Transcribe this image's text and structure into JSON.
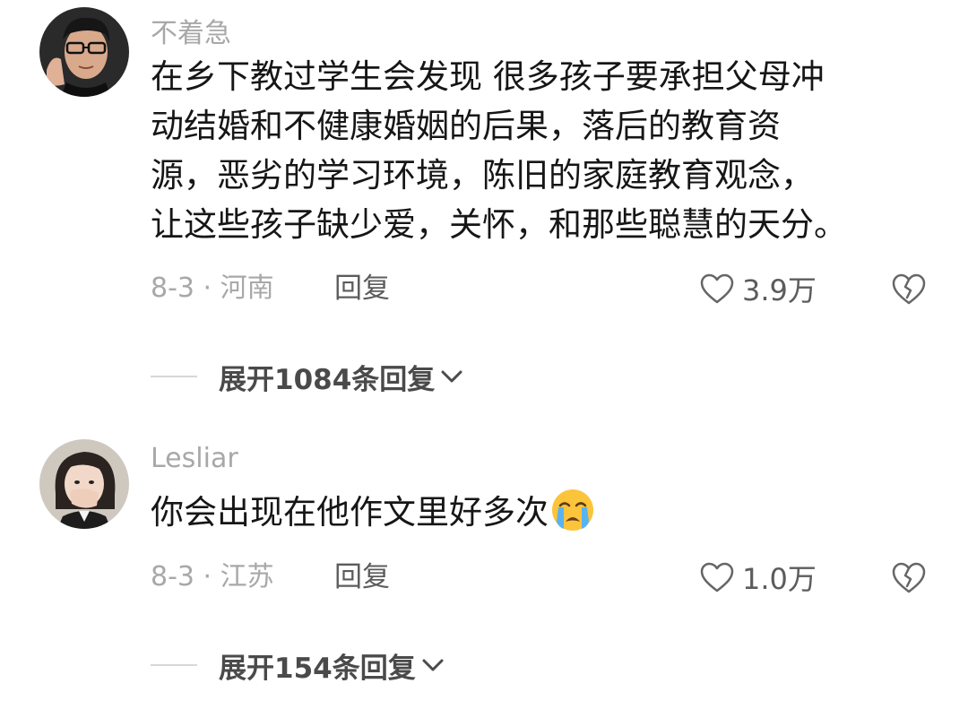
{
  "comments": [
    {
      "username": "不着急",
      "avatar_icon": "avatar-man-glasses",
      "lines": [
        "在乡下教过学生会发现 很多孩子要承担父母冲",
        "动结婚和不健康婚姻的后果，落后的教育资",
        "源，恶劣的学习环境，陈旧的家庭教育观念，",
        "让这些孩子缺少爱，关怀，和那些聪慧的天分。"
      ],
      "date_location": "8-3 · 河南",
      "reply_label": "回复",
      "like_count": "3.9万",
      "like_icon": "heart-outline-icon",
      "dislike_icon": "broken-heart-icon",
      "expand_label": "展开1084条回复"
    },
    {
      "username": "Lesliar",
      "avatar_icon": "avatar-woman-covering-mouth",
      "lines": [
        "你会出现在他作文里好多次"
      ],
      "emoji": "loudly-crying-face-emoji",
      "date_location": "8-3 · 江苏",
      "reply_label": "回复",
      "like_count": "1.0万",
      "like_icon": "heart-outline-icon",
      "dislike_icon": "broken-heart-icon",
      "expand_label": "展开154条回复"
    }
  ],
  "colors": {
    "username": "#a8a8a8",
    "body": "#161616",
    "meta": "#a8a8a8",
    "action": "#5c5c5c",
    "divider": "#d7d7d7"
  }
}
